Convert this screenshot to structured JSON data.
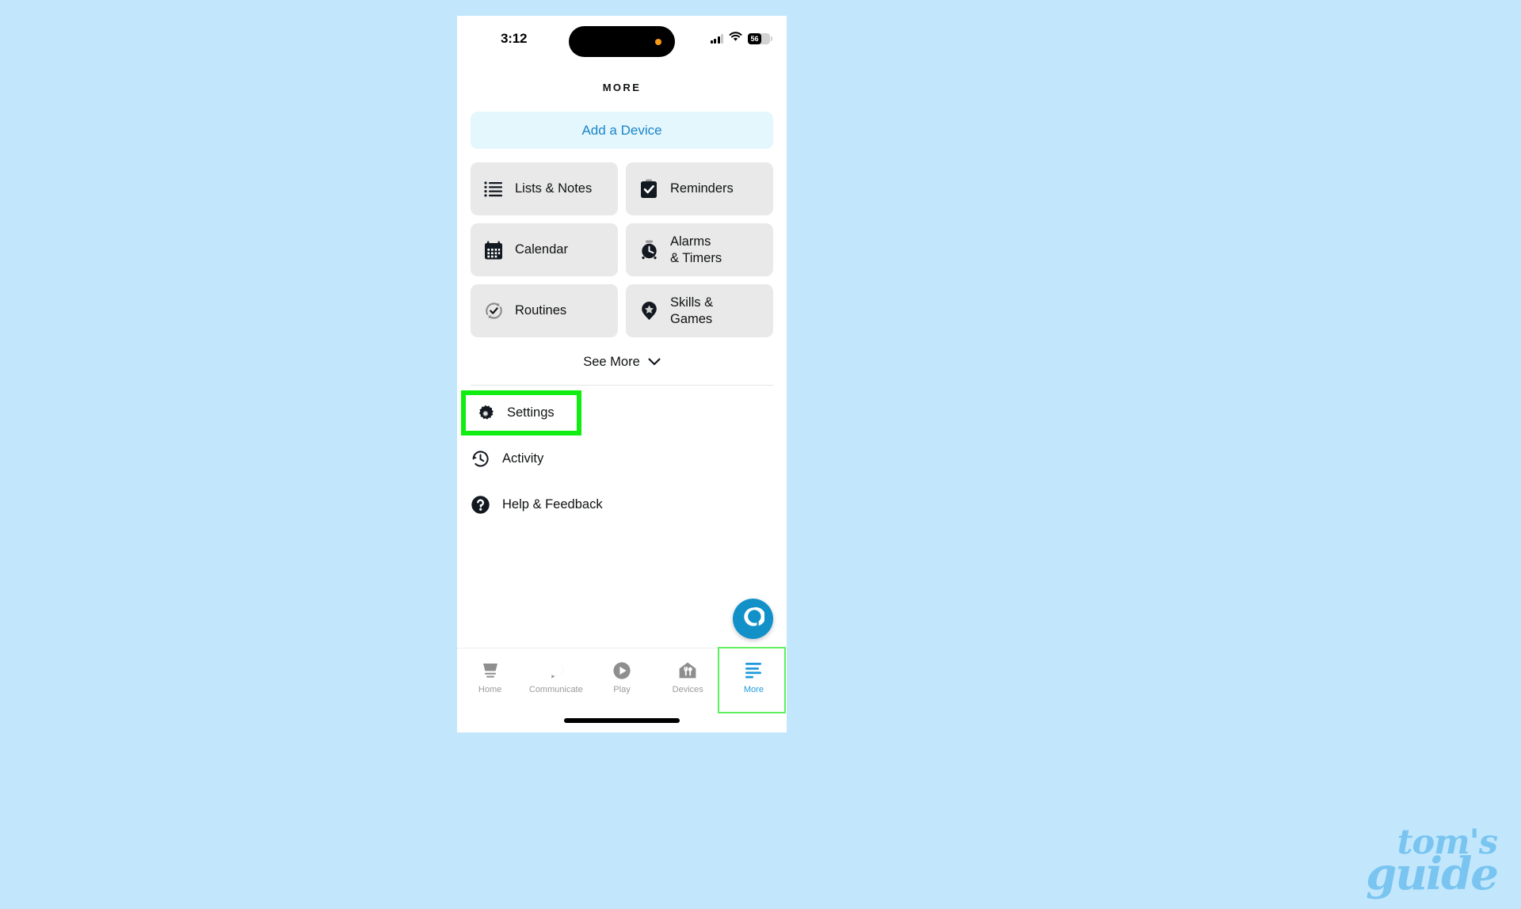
{
  "background_color": "#c2e7fc",
  "status_bar": {
    "time": "3:12",
    "battery_percent": "56",
    "signal_icon": "signal-bars-icon",
    "wifi_icon": "wifi-icon",
    "battery_icon": "battery-icon",
    "island_dot_color": "#f79b19"
  },
  "header": {
    "title": "MORE"
  },
  "add_device": {
    "label": "Add a Device",
    "text_color": "#1b84c9",
    "background_color": "#e4f7fd"
  },
  "tiles": [
    {
      "label": "Lists & Notes",
      "icon": "list-lines-icon"
    },
    {
      "label": "Reminders",
      "icon": "clipboard-check-icon"
    },
    {
      "label": "Calendar",
      "icon": "calendar-icon"
    },
    {
      "label": "Alarms\n& Timers",
      "icon": "alarm-clock-icon"
    },
    {
      "label": "Routines",
      "icon": "routine-refresh-check-icon"
    },
    {
      "label": "Skills &\nGames",
      "icon": "map-pin-star-icon"
    }
  ],
  "see_more": {
    "label": "See More",
    "icon": "chevron-down-icon"
  },
  "list_items": [
    {
      "label": "Settings",
      "icon": "gear-icon",
      "highlighted": true
    },
    {
      "label": "Activity",
      "icon": "clock-history-icon",
      "highlighted": false
    },
    {
      "label": "Help & Feedback",
      "icon": "question-circle-icon",
      "highlighted": false
    }
  ],
  "alexa_button": {
    "icon": "alexa-ring-icon",
    "color": "#1291c9"
  },
  "bottom_nav": {
    "items": [
      {
        "label": "Home",
        "icon": "home-icon",
        "active": false
      },
      {
        "label": "Communicate",
        "icon": "speech-bubble-icon",
        "active": false
      },
      {
        "label": "Play",
        "icon": "play-circle-icon",
        "active": false
      },
      {
        "label": "Devices",
        "icon": "devices-house-icon",
        "active": false
      },
      {
        "label": "More",
        "icon": "more-lines-icon",
        "active": true
      }
    ],
    "active_color": "#1f9bdd",
    "inactive_color": "#9a9a9a"
  },
  "annotation": {
    "highlight_color": "#11ec11",
    "nav_highlight_color": "#5ef05e"
  },
  "watermark": {
    "line1": "tom's",
    "line2": "guide"
  }
}
